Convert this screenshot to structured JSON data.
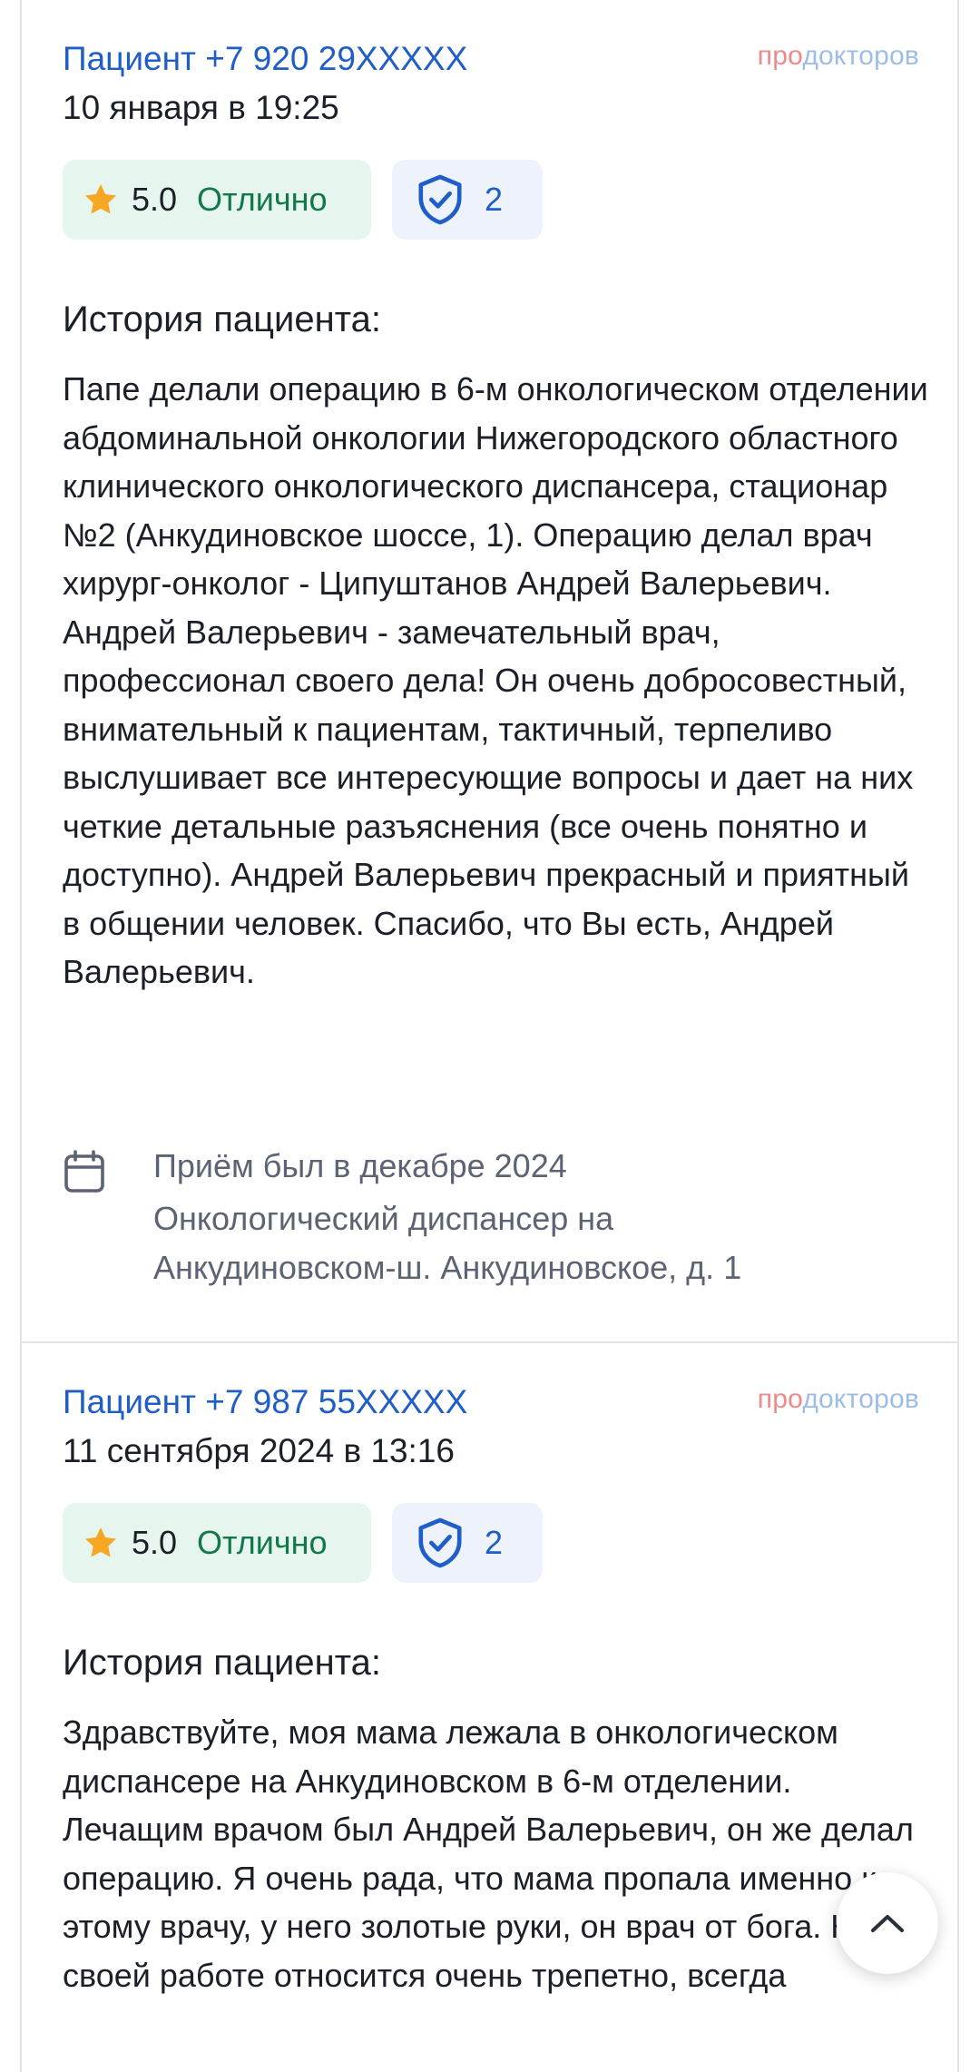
{
  "brand": {
    "part1": "про",
    "part2": "докторов"
  },
  "reviews": [
    {
      "author": "Пациент +7 920 29XXXXX",
      "date": "10 января в 19:25",
      "rating": "5.0",
      "rating_label": "Отлично",
      "verify_count": "2",
      "heading": "История пациента:",
      "text": "Папе делали операцию в 6-м онкологическом отделении абдоминальной онкологии Нижегородского областного клинического онкологического диспансера, стационар №2 (Анкудиновское шоссе, 1). Операцию делал врач хирург-онколог - Ципуштанов Андрей Валерьевич. Андрей Валерьевич - замечательный врач, профессионал своего дела! Он очень добросовестный, внимательный к пациентам, тактичный, терпеливо выслушивает все интересующие вопросы и дает на них четкие детальные разъяснения (все очень понятно и доступно). Андрей Валерьевич прекрасный и приятный в общении человек. Спасибо, что Вы есть, Андрей Валерьевич.",
      "visit": {
        "when": "Приём был в декабре 2024",
        "clinic_line1": "Онкологический диспансер на",
        "clinic_line2": "Анкудиновском-ш. Анкудиновское, д. 1"
      }
    },
    {
      "author": "Пациент +7 987 55XXXXX",
      "date": "11 сентября 2024 в 13:16",
      "rating": "5.0",
      "rating_label": "Отлично",
      "verify_count": "2",
      "heading": "История пациента:",
      "text": "Здравствуйте, моя мама лежала в онкологическом диспансере на Анкудиновском в 6-м отделении. Лечащим врачом был Андрей Валерьевич, он же делал операцию. Я очень рада, что мама пропала именно к этому врачу, у него золотые руки, он врач от бога. К своей работе относится очень трепетно, всегда"
    }
  ],
  "colors": {
    "link": "#1f5ec9",
    "rating_bg": "#e6f6ee",
    "rating_text": "#12784a",
    "star": "#f5a623",
    "verify_bg": "#eef3fb"
  },
  "icons": [
    "star-icon",
    "shield-check-icon",
    "calendar-icon",
    "chevron-up-icon"
  ]
}
